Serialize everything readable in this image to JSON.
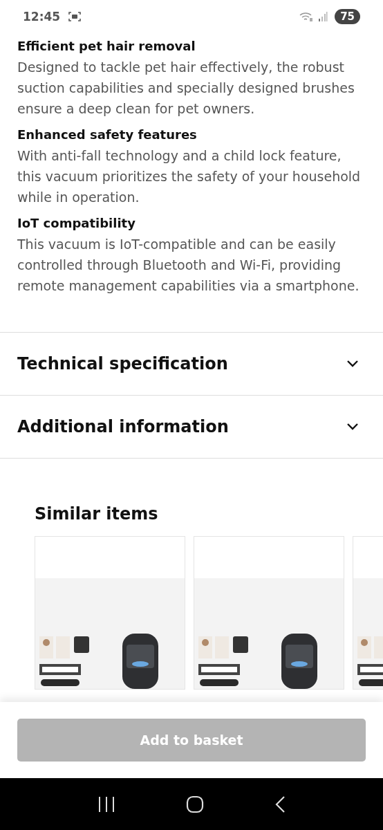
{
  "status_bar": {
    "time": "12:45",
    "battery": "75"
  },
  "features": [
    {
      "title": "Efficient pet hair removal",
      "text": "Designed to tackle pet hair effectively, the robust suction capabilities and specially designed brushes ensure a deep clean for pet owners."
    },
    {
      "title": "Enhanced safety features",
      "text": "With anti-fall technology and a child lock feature, this vacuum prioritizes the safety of your household while in operation."
    },
    {
      "title": "IoT compatibility",
      "text": "This vacuum is IoT-compatible and can be easily controlled through Bluetooth and Wi-Fi, providing remote management capabilities via a smartphone."
    }
  ],
  "accordions": [
    {
      "label": "Technical specification",
      "expanded": false
    },
    {
      "label": "Additional information",
      "expanded": false
    }
  ],
  "similar_items": {
    "title": "Similar items"
  },
  "basket_button": {
    "label": "Add to basket",
    "disabled": true
  }
}
